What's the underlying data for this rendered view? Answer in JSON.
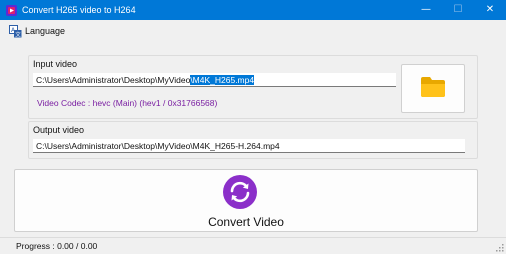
{
  "window": {
    "title": "Convert H265 video to H264",
    "minimize_glyph": "—",
    "maximize_glyph": "☐",
    "close_glyph": "✕",
    "accent_color": "#0078d7"
  },
  "menu": {
    "language_label": "Language",
    "language_icon": "language-icon"
  },
  "input_group": {
    "title": "Input video",
    "path_prefix": "C:\\Users\\Administrator\\Desktop\\MyVideo",
    "path_selected": "\\M4K_H265.mp4",
    "codec_text": "Video Codec : hevc (Main) (hev1 / 0x31766568)",
    "codec_color": "#7a1fa2",
    "browse_icon": "folder-icon"
  },
  "output_group": {
    "title": "Output video",
    "path": "C:\\Users\\Administrator\\Desktop\\MyVideo\\M4K_H265-H.264.mp4"
  },
  "convert": {
    "label": "Convert Video",
    "icon": "convert-arrows-icon",
    "icon_color": "#8b2fc9"
  },
  "status": {
    "text": "Progress : 0.00 / 0.00"
  }
}
